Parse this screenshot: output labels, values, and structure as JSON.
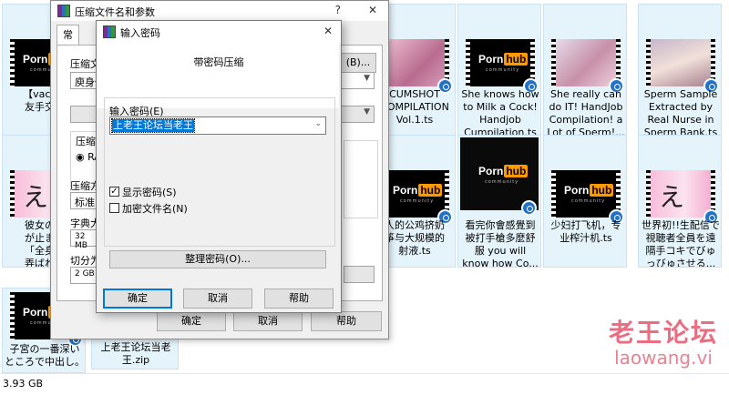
{
  "explorer": {
    "tiles": [
      {
        "name": "【vacme\n友手交龟",
        "kind": "ph"
      },
      {
        "name": "CUMSHOT\nCOMPILATION\nVol.1.ts",
        "kind": "photo"
      },
      {
        "name": "She knows how\nto Milk a Cock!\nHandjob\nCumpilation.ts",
        "kind": "ph"
      },
      {
        "name": "She really can\ndo IT! HandJob\nCompilation! a\nLot of Sperm!...",
        "kind": "photo"
      },
      {
        "name": "Sperm Sample\nExtracted by\nReal Nurse in\nSperm Bank.ts",
        "kind": "photo"
      },
      {
        "name": "彼女のえ\nが止まら\n「全身ビ\n弄ばれ、",
        "kind": "pink"
      },
      {
        "name": "人的公鸡挤奶\n筝与大规模的\n射液.ts",
        "kind": "ph"
      },
      {
        "name": "看完你會感覺到\n被打手槍多麼舒\n服 you will\nknow how Co...",
        "kind": "black"
      },
      {
        "name": "少妇打飞机，专\n业榨汁机.ts",
        "kind": "ph"
      },
      {
        "name": "世界初!!生配信で\n視聴者全員を遠\n隔手コキでびゅ\nっびゅさせる...",
        "kind": "pink"
      },
      {
        "name": "子宮の一番深い\nところで中出し。\n...",
        "kind": "ph"
      }
    ],
    "ph_logo_left": "Porn",
    "ph_logo_right": "hub",
    "ph_sub": "community",
    "zip_name": "上老王论坛当老\n王.zip",
    "status_text": "3.93 GB"
  },
  "watermark": {
    "title": "老王论坛",
    "url": "laowang.vi"
  },
  "archive_dialog": {
    "title": "压缩文件名和参数",
    "help_glyph": "?",
    "close_glyph": "✕",
    "tab_general": "常规",
    "archive_name_label": "压缩文",
    "browse_label": "(B)...",
    "archive_name_value": "庾身低",
    "format_label": "压缩",
    "format_option": "RA",
    "method_label": "压缩方",
    "method_value": "标准",
    "dict_label": "字典大",
    "dict_value": "32 MB",
    "split_label": "切分为",
    "split_value": "2 GB",
    "ok_label": "确定",
    "cancel_label": "取消",
    "help_label": "帮助"
  },
  "password_dialog": {
    "title": "输入密码",
    "close_glyph": "✕",
    "heading": "带密码压缩",
    "input_label": "输入密码(E)",
    "input_value": "上老王论坛当老王",
    "show_password_label": "显示密码(S)",
    "show_password_checked": true,
    "encrypt_names_label": "加密文件名(N)",
    "encrypt_names_checked": false,
    "organize_label": "整理密码(O)...",
    "ok_label": "确定",
    "cancel_label": "取消",
    "help_label": "帮助"
  }
}
